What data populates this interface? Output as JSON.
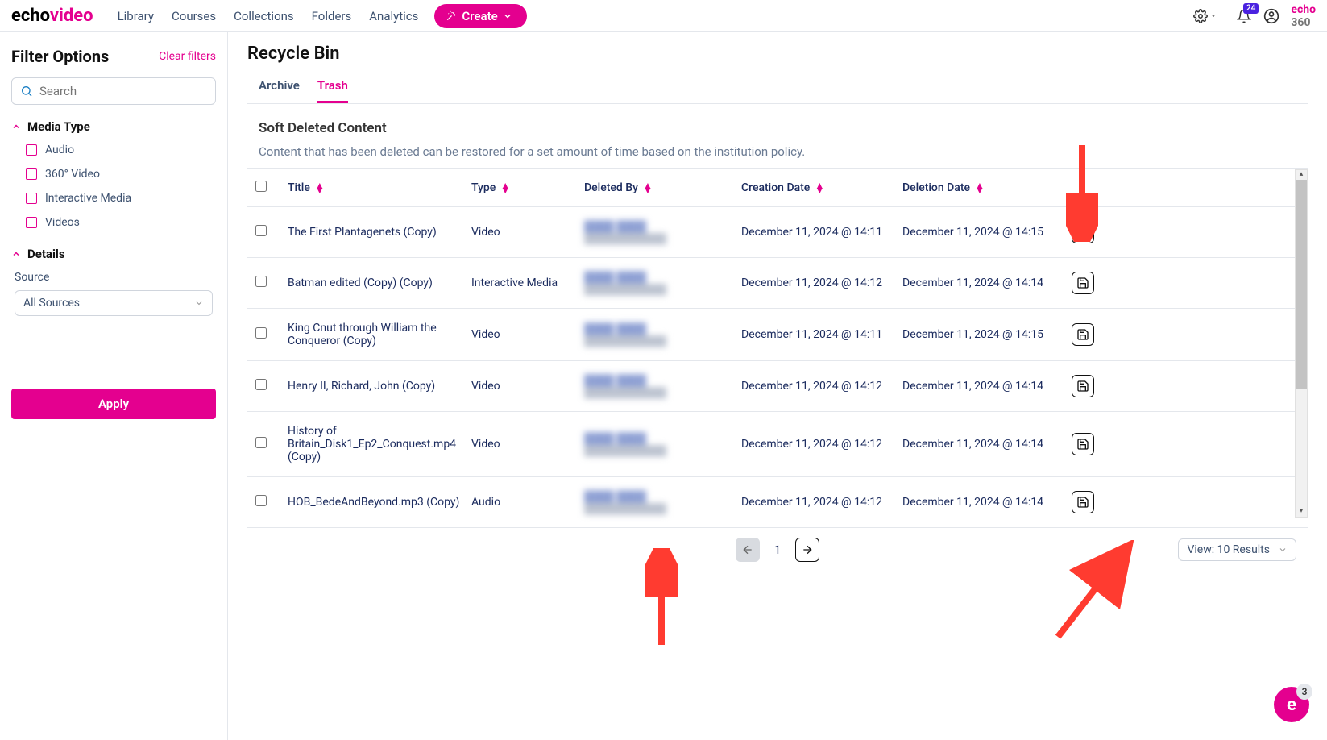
{
  "logo": {
    "part1": "echo",
    "part2": "video"
  },
  "nav": {
    "items": [
      "Library",
      "Courses",
      "Collections",
      "Folders",
      "Analytics"
    ]
  },
  "createBtn": "Create",
  "notifBadge": "24",
  "logo2": {
    "p1": "echo",
    "p2": "360"
  },
  "sidebar": {
    "title": "Filter Options",
    "clear": "Clear filters",
    "searchPlaceholder": "Search",
    "mediaType": "Media Type",
    "mediaOpts": [
      "Audio",
      "360° Video",
      "Interactive Media",
      "Videos"
    ],
    "details": "Details",
    "sourceLabel": "Source",
    "sourceValue": "All Sources",
    "apply": "Apply"
  },
  "main": {
    "title": "Recycle Bin",
    "tabs": [
      "Archive",
      "Trash"
    ],
    "activeTab": 1,
    "subTitle": "Soft Deleted Content",
    "subDesc": "Content that has been deleted can be restored for a set amount of time based on the institution policy.",
    "columns": [
      "Title",
      "Type",
      "Deleted By",
      "Creation Date",
      "Deletion Date"
    ],
    "rows": [
      {
        "title": "The First Plantagenets (Copy)",
        "type": "Video",
        "cd": "December 11, 2024 @ 14:11",
        "dd": "December 11, 2024 @ 14:15"
      },
      {
        "title": "Batman edited (Copy) (Copy)",
        "type": "Interactive Media",
        "cd": "December 11, 2024 @ 14:12",
        "dd": "December 11, 2024 @ 14:14"
      },
      {
        "title": "King Cnut through William the Conqueror (Copy)",
        "type": "Video",
        "cd": "December 11, 2024 @ 14:11",
        "dd": "December 11, 2024 @ 14:15"
      },
      {
        "title": "Henry II, Richard, John (Copy)",
        "type": "Video",
        "cd": "December 11, 2024 @ 14:12",
        "dd": "December 11, 2024 @ 14:14"
      },
      {
        "title": "History of Britain_Disk1_Ep2_Conquest.mp4 (Copy)",
        "type": "Video",
        "cd": "December 11, 2024 @ 14:12",
        "dd": "December 11, 2024 @ 14:14"
      },
      {
        "title": "HOB_BedeAndBeyond.mp3 (Copy)",
        "type": "Audio",
        "cd": "December 11, 2024 @ 14:12",
        "dd": "December 11, 2024 @ 14:14"
      }
    ],
    "pageNum": "1",
    "viewLabel": "View: 10 Results"
  },
  "fabBadge": "3"
}
